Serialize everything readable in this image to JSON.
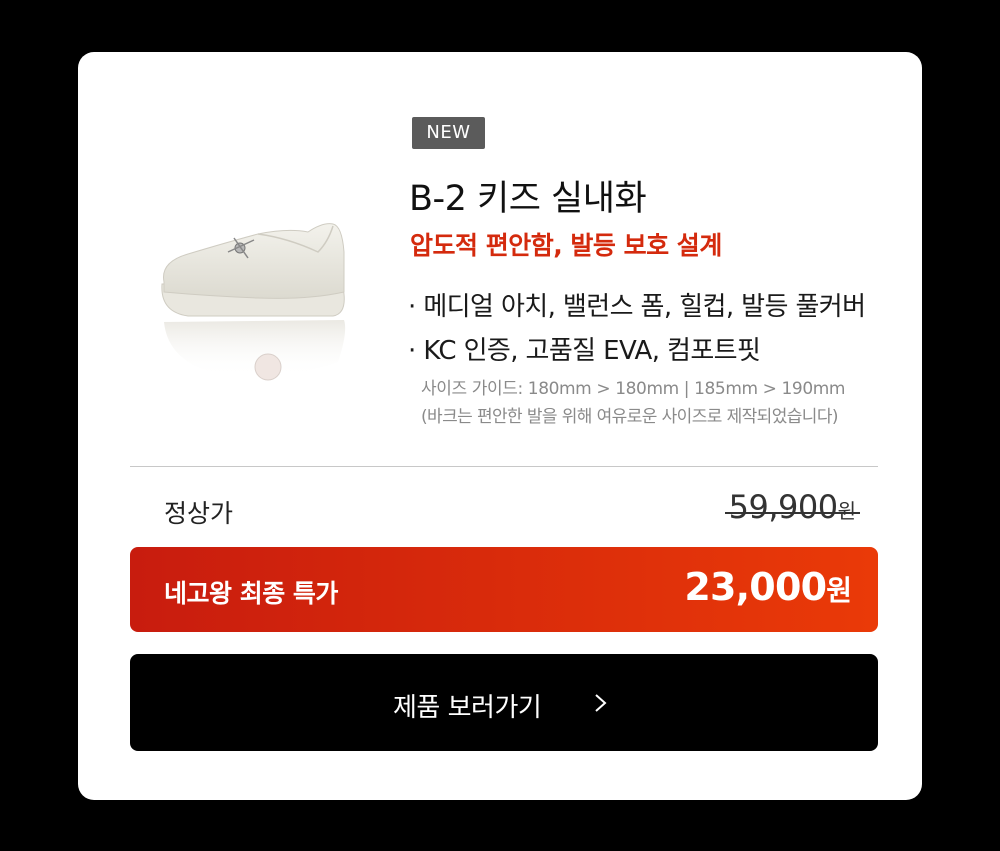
{
  "product": {
    "badge": "NEW",
    "title": "B-2 키즈 실내화",
    "subtitle": "압도적 편안함, 발등 보호 설계",
    "features": [
      "· 메디얼 아치, 밸런스 폼, 힐컵, 발등 풀커버",
      "· KC 인증, 고품질 EVA, 컴포트핏"
    ],
    "size_guide": "사이즈 가이드: 180mm > 180mm   |   185mm > 190mm",
    "size_note": "(바크는 편안한 발을 위해 여유로운 사이즈로 제작되었습니다)",
    "image_icon": "white-shoe-image"
  },
  "pricing": {
    "regular_label": "정상가",
    "regular_price": "59,900",
    "regular_unit": "원",
    "special_label": "네고왕 최종 특가",
    "special_price": "23,000",
    "special_unit": "원"
  },
  "cta": {
    "label": "제품 보러가기",
    "icon": "chevron-right-icon"
  },
  "colors": {
    "background": "#000000",
    "card": "#ffffff",
    "accent_red": "#d42a0d",
    "badge": "#5b5b5b",
    "button": "#000000"
  }
}
